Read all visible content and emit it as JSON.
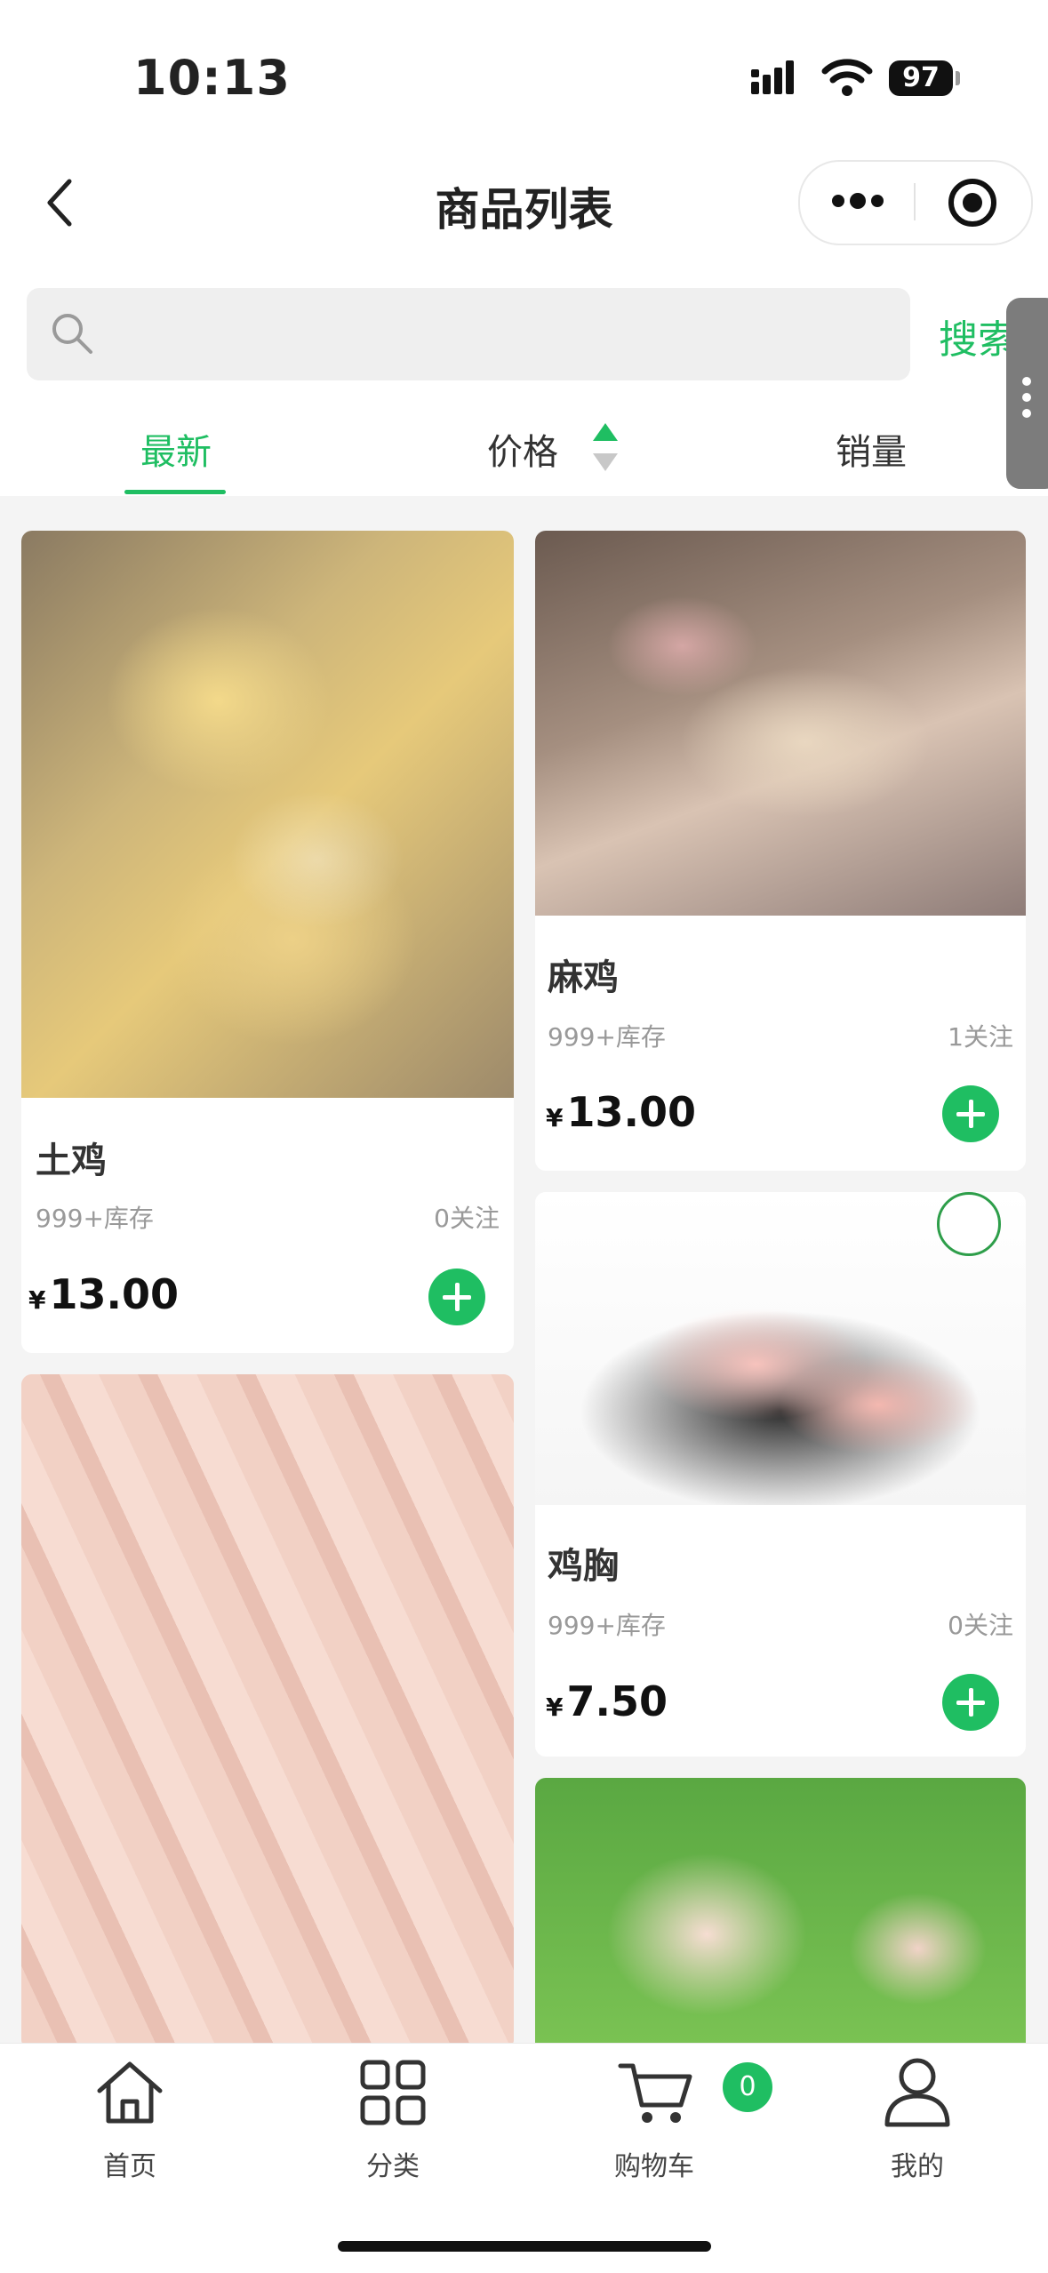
{
  "status_bar": {
    "time": "10:13",
    "battery": "97"
  },
  "nav": {
    "title": "商品列表"
  },
  "search": {
    "placeholder": "",
    "button": "搜索"
  },
  "sort_tabs": [
    {
      "label": "最新",
      "active": true
    },
    {
      "label": "价格",
      "active": false
    },
    {
      "label": "销量",
      "active": false
    }
  ],
  "products": [
    {
      "name": "土鸡",
      "stock": "999+库存",
      "follows": "0关注",
      "currency": "¥",
      "price": "13.00"
    },
    {
      "name": "麻鸡",
      "stock": "999+库存",
      "follows": "1关注",
      "currency": "¥",
      "price": "13.00"
    },
    {
      "name": "鸡胸",
      "stock": "999+库存",
      "follows": "0关注",
      "currency": "¥",
      "price": "7.50"
    }
  ],
  "tabbar": {
    "home": "首页",
    "category": "分类",
    "cart": "购物车",
    "cart_count": "0",
    "me": "我的"
  },
  "colors": {
    "accent": "#1fbe62",
    "background": "#f4f4f4"
  }
}
